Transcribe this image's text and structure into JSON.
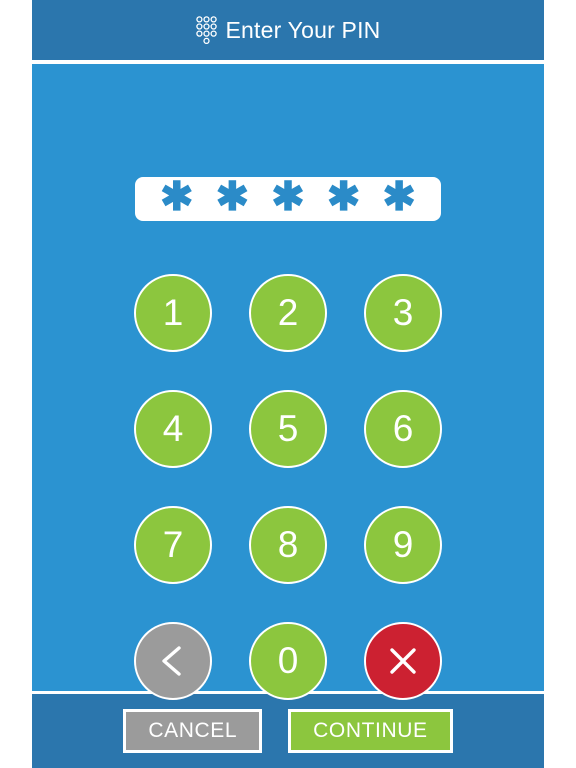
{
  "header": {
    "icon": "dialpad-icon",
    "title": "Enter Your PIN"
  },
  "pin": {
    "mask_char": "✱",
    "length": 5,
    "entered": [
      "✱",
      "✱",
      "✱",
      "✱",
      "✱"
    ]
  },
  "keypad": {
    "rows": [
      [
        {
          "label": "1",
          "name": "key-1",
          "kind": "digit"
        },
        {
          "label": "2",
          "name": "key-2",
          "kind": "digit"
        },
        {
          "label": "3",
          "name": "key-3",
          "kind": "digit"
        }
      ],
      [
        {
          "label": "4",
          "name": "key-4",
          "kind": "digit"
        },
        {
          "label": "5",
          "name": "key-5",
          "kind": "digit"
        },
        {
          "label": "6",
          "name": "key-6",
          "kind": "digit"
        }
      ],
      [
        {
          "label": "7",
          "name": "key-7",
          "kind": "digit"
        },
        {
          "label": "8",
          "name": "key-8",
          "kind": "digit"
        },
        {
          "label": "9",
          "name": "key-9",
          "kind": "digit"
        }
      ],
      [
        {
          "label": "",
          "name": "key-backspace",
          "kind": "backspace",
          "icon": "chevron-left-icon"
        },
        {
          "label": "0",
          "name": "key-0",
          "kind": "digit"
        },
        {
          "label": "",
          "name": "key-clear",
          "kind": "clear",
          "icon": "close-x-icon"
        }
      ]
    ]
  },
  "footer": {
    "cancel_label": "CANCEL",
    "continue_label": "CONTINUE"
  },
  "colors": {
    "header_blue": "#2b76ad",
    "body_blue": "#2b93d1",
    "green": "#8cc63e",
    "red": "#cc2131",
    "gray": "#9b9b9b",
    "white": "#ffffff",
    "asterisk_blue": "#2b8bc8"
  }
}
